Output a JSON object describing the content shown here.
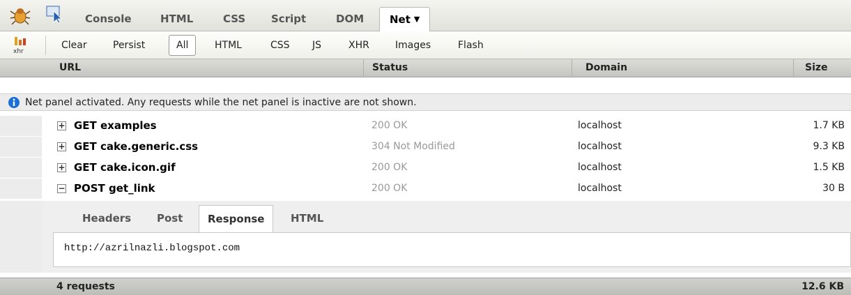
{
  "toolbar": {
    "tabs": [
      {
        "label": "Console",
        "active": false
      },
      {
        "label": "HTML",
        "active": false
      },
      {
        "label": "CSS",
        "active": false
      },
      {
        "label": "Script",
        "active": false
      },
      {
        "label": "DOM",
        "active": false
      },
      {
        "label": "Net",
        "active": true
      }
    ],
    "icons": [
      "firebug-icon",
      "inspect-icon",
      "dropdown-caret-icon"
    ]
  },
  "filter_bar": {
    "icon_label": "xhr",
    "buttons": [
      {
        "label": "Clear",
        "active": false
      },
      {
        "label": "Persist",
        "active": false
      },
      {
        "label": "All",
        "active": true
      },
      {
        "label": "HTML",
        "active": false
      },
      {
        "label": "CSS",
        "active": false
      },
      {
        "label": "JS",
        "active": false
      },
      {
        "label": "XHR",
        "active": false
      },
      {
        "label": "Images",
        "active": false
      },
      {
        "label": "Flash",
        "active": false
      }
    ]
  },
  "columns": [
    "URL",
    "Status",
    "Domain",
    "Size"
  ],
  "info_message": "Net panel activated. Any requests while the net panel is inactive are not shown.",
  "requests": [
    {
      "url": "GET examples",
      "status": "200 OK",
      "domain": "localhost",
      "size": "1.7 KB",
      "expanded": false,
      "toggle": "+"
    },
    {
      "url": "GET cake.generic.css",
      "status": "304 Not Modified",
      "domain": "localhost",
      "size": "9.3 KB",
      "expanded": false,
      "toggle": "+"
    },
    {
      "url": "GET cake.icon.gif",
      "status": "200 OK",
      "domain": "localhost",
      "size": "1.5 KB",
      "expanded": false,
      "toggle": "+"
    },
    {
      "url": "POST get_link",
      "status": "200 OK",
      "domain": "localhost",
      "size": "30 B",
      "expanded": true,
      "toggle": "−"
    }
  ],
  "detail": {
    "tabs": [
      {
        "label": "Headers",
        "active": false
      },
      {
        "label": "Post",
        "active": false
      },
      {
        "label": "Response",
        "active": true
      },
      {
        "label": "HTML",
        "active": false
      }
    ],
    "response_text": "http://azrilnazli.blogspot.com"
  },
  "footer": {
    "count": "4 requests",
    "total": "12.6 KB"
  },
  "colors": {
    "toolbar_bg": "#e8e8e2",
    "header_bg": "#cfcfcb",
    "info_bg": "#ececec",
    "status_text": "#999999",
    "info_icon": "#1a6fd6"
  }
}
